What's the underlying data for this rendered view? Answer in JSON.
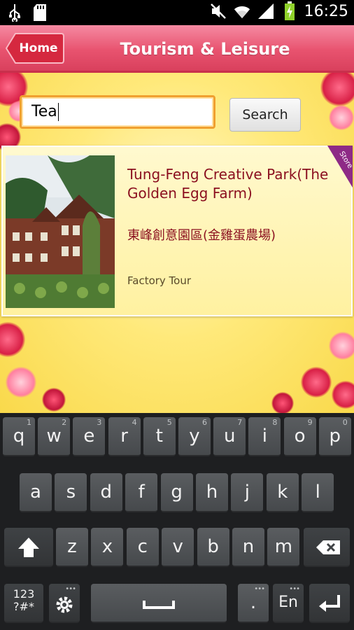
{
  "status_bar": {
    "time": "16:25",
    "icons": [
      "usb-icon",
      "sd-card-icon",
      "mute-icon",
      "wifi-icon",
      "signal-icon",
      "battery-charging-icon"
    ]
  },
  "header": {
    "home_label": "Home",
    "title": "Tourism & Leisure",
    "color": "#e8536f"
  },
  "search": {
    "value": "Tea",
    "button_label": "Search"
  },
  "results": [
    {
      "name_en": "Tung-Feng Creative Park(The Golden Egg Farm)",
      "name_zh": "東峰創意園區(金雞蛋農場)",
      "category": "Factory Tour",
      "badge": "Store"
    }
  ],
  "keyboard": {
    "row1": [
      {
        "k": "q",
        "n": "1"
      },
      {
        "k": "w",
        "n": "2"
      },
      {
        "k": "e",
        "n": "3"
      },
      {
        "k": "r",
        "n": "4"
      },
      {
        "k": "t",
        "n": "5"
      },
      {
        "k": "y",
        "n": "6"
      },
      {
        "k": "u",
        "n": "7"
      },
      {
        "k": "i",
        "n": "8"
      },
      {
        "k": "o",
        "n": "9"
      },
      {
        "k": "p",
        "n": "0"
      }
    ],
    "row2": [
      "a",
      "s",
      "d",
      "f",
      "g",
      "h",
      "j",
      "k",
      "l"
    ],
    "row3": [
      "z",
      "x",
      "c",
      "v",
      "b",
      "n",
      "m"
    ],
    "symbols_label": "123\n?#*",
    "period_label": ".",
    "language_label": "En"
  }
}
